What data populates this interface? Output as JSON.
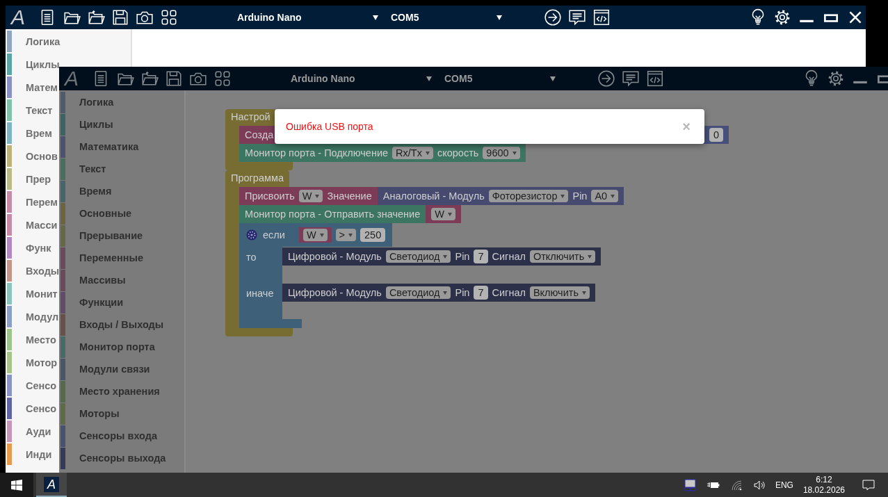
{
  "windows": [
    {
      "kind": "blank",
      "logo": "A",
      "board": "Arduino Nano",
      "port": "COM5",
      "sidebar": [
        {
          "label": "Логика",
          "color": "#8fa5c0"
        },
        {
          "label": "Циклы",
          "color": "#5ba5a5"
        },
        {
          "label": "Матем",
          "color": "#8b92c3"
        },
        {
          "label": "Текст",
          "color": "#7fc4a8"
        },
        {
          "label": "Врем",
          "color": "#7fb4c0"
        },
        {
          "label": "Основ",
          "color": "#bdb27a"
        },
        {
          "label": "Прер",
          "color": "#b8bb88"
        },
        {
          "label": "Перем",
          "color": "#c48aa6"
        },
        {
          "label": "Масси",
          "color": "#c48aa6"
        },
        {
          "label": "Функ",
          "color": "#b389c4"
        },
        {
          "label": "Входы",
          "color": "#c4968a"
        },
        {
          "label": "Монит",
          "color": "#8ac4b8"
        },
        {
          "label": "Модул",
          "color": "#8aa0c4"
        },
        {
          "label": "Место",
          "color": "#9cc48a"
        },
        {
          "label": "Мотор",
          "color": "#a9c48a"
        },
        {
          "label": "Сенсо",
          "color": "#8a94c4"
        },
        {
          "label": "Сенсо",
          "color": "#5f65a0"
        },
        {
          "label": "Ауди",
          "color": "#c496b8"
        },
        {
          "label": "Инди",
          "color": "#e69a50"
        }
      ]
    },
    {
      "kind": "editor",
      "logo": "A",
      "board": "Arduino Nano",
      "port": "COM5",
      "sidebar": [
        {
          "label": "Логика",
          "color": "#4f5a6a"
        },
        {
          "label": "Циклы",
          "color": "#3a6464"
        },
        {
          "label": "Математика",
          "color": "#4d5170"
        },
        {
          "label": "Текст",
          "color": "#486e5e"
        },
        {
          "label": "Время",
          "color": "#46646a"
        },
        {
          "label": "Основные",
          "color": "#6a6440"
        },
        {
          "label": "Прерывание",
          "color": "#66684a"
        },
        {
          "label": "Переменные",
          "color": "#6a4a5a"
        },
        {
          "label": "Массивы",
          "color": "#6a4a5a"
        },
        {
          "label": "Функции",
          "color": "#624a6a"
        },
        {
          "label": "Входы / Выходы",
          "color": "#6a4e48"
        },
        {
          "label": "Монитор порта",
          "color": "#486a64"
        },
        {
          "label": "Модули связи",
          "color": "#4a5668"
        },
        {
          "label": "Место хранения",
          "color": "#556a48"
        },
        {
          "label": "Моторы",
          "color": "#5e6a48"
        },
        {
          "label": "Сенсоры входа",
          "color": "#4a5070"
        },
        {
          "label": "Сенсоры выхода",
          "color": "#353a58"
        }
      ],
      "workspace": {
        "containers": [
          {
            "label": "Настрой",
            "color": "#776d33",
            "statements": [
              {
                "kind": "plain",
                "color": "#7c3b57",
                "segments": [
                  {
                    "kind": "text",
                    "text": "Созда"
                  }
                ],
                "value": {
                  "color": "#46507a",
                  "segments": [
                    {
                      "kind": "number",
                      "text": "0"
                    }
                  ]
                }
              },
              {
                "kind": "plain",
                "color": "#3c7562",
                "segments": [
                  {
                    "kind": "text",
                    "text": "Монитор порта - Подключение"
                  },
                  {
                    "kind": "dropdown",
                    "text": "Rx/Tx"
                  },
                  {
                    "kind": "text",
                    "text": "скорость"
                  },
                  {
                    "kind": "dropdown",
                    "text": "9600"
                  }
                ]
              }
            ]
          },
          {
            "label": "Программа",
            "color": "#776d33",
            "statements": [
              {
                "kind": "plain",
                "color": "#7c3b57",
                "segments": [
                  {
                    "kind": "text",
                    "text": "Присвоить"
                  },
                  {
                    "kind": "dropdown",
                    "text": "W"
                  },
                  {
                    "kind": "text",
                    "text": "Значение"
                  }
                ],
                "value": {
                  "color": "#454a6e",
                  "segments": [
                    {
                      "kind": "text",
                      "text": "Аналоговый - Модуль"
                    },
                    {
                      "kind": "dropdown",
                      "text": "Фоторезистор"
                    },
                    {
                      "kind": "text",
                      "text": "Pin"
                    },
                    {
                      "kind": "dropdown",
                      "text": "A0"
                    }
                  ]
                }
              },
              {
                "kind": "plain",
                "color": "#3c7562",
                "segments": [
                  {
                    "kind": "text",
                    "text": "Монитор порта - Отправить значение"
                  }
                ],
                "value": {
                  "color": "#7c3b57",
                  "segments": [
                    {
                      "kind": "dropdown",
                      "text": "W"
                    }
                  ]
                }
              },
              {
                "kind": "if",
                "color": "#3e6078",
                "label": "если",
                "condition": [
                  {
                    "kind": "value",
                    "color": "#7c3b57",
                    "segments": [
                      {
                        "kind": "dropdown",
                        "text": "W"
                      }
                    ]
                  },
                  {
                    "kind": "dropdown",
                    "text": ">"
                  },
                  {
                    "kind": "number",
                    "text": "250"
                  }
                ],
                "branches": [
                  {
                    "label": "то",
                    "statement": {
                      "color": "#2c3048",
                      "segments": [
                        {
                          "kind": "text",
                          "text": "Цифровой - Модуль"
                        },
                        {
                          "kind": "dropdown",
                          "text": "Светодиод"
                        },
                        {
                          "kind": "text",
                          "text": "Pin"
                        },
                        {
                          "kind": "number",
                          "text": "7"
                        },
                        {
                          "kind": "text",
                          "text": "Сигнал"
                        },
                        {
                          "kind": "dropdown",
                          "text": "Отключить"
                        }
                      ]
                    }
                  },
                  {
                    "label": "иначе",
                    "statement": {
                      "color": "#2c3048",
                      "segments": [
                        {
                          "kind": "text",
                          "text": "Цифровой - Модуль"
                        },
                        {
                          "kind": "dropdown",
                          "text": "Светодиод"
                        },
                        {
                          "kind": "text",
                          "text": "Pin"
                        },
                        {
                          "kind": "number",
                          "text": "7"
                        },
                        {
                          "kind": "text",
                          "text": "Сигнал"
                        },
                        {
                          "kind": "dropdown",
                          "text": "Включить"
                        }
                      ]
                    }
                  }
                ]
              }
            ]
          }
        ]
      },
      "dialog": {
        "message": "Ошибка USB порта",
        "close": "×"
      }
    }
  ],
  "taskbar": {
    "app_logo": "A",
    "language": "ENG",
    "time": "6:12",
    "date": "18.02.2026"
  }
}
